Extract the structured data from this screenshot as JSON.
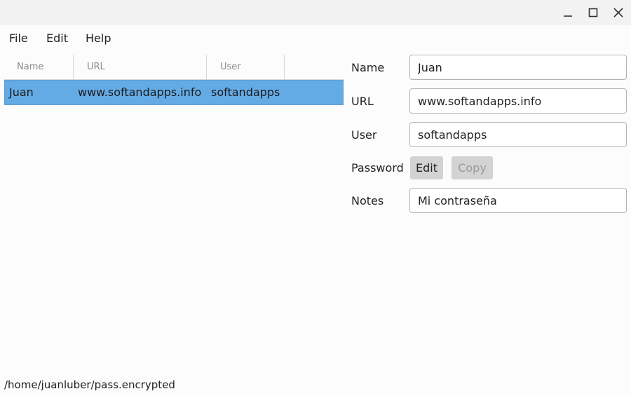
{
  "window": {
    "controls": [
      {
        "name": "minimize",
        "icon": "minimize-icon"
      },
      {
        "name": "maximize",
        "icon": "maximize-icon"
      },
      {
        "name": "close",
        "icon": "close-icon"
      }
    ]
  },
  "menu": {
    "items": [
      {
        "label": "File"
      },
      {
        "label": "Edit"
      },
      {
        "label": "Help"
      }
    ]
  },
  "table": {
    "columns": [
      "Name",
      "URL",
      "User"
    ],
    "rows": [
      {
        "name": "Juan",
        "url": "www.softandapps.info",
        "user": "softandapps",
        "selected": true
      }
    ],
    "selection_color": "#64abe5"
  },
  "form": {
    "name": {
      "label": "Name",
      "value": "Juan"
    },
    "url": {
      "label": "URL",
      "value": "www.softandapps.info"
    },
    "user": {
      "label": "User",
      "value": "softandapps"
    },
    "password": {
      "label": "Password",
      "edit_label": "Edit",
      "copy_label": "Copy",
      "copy_disabled": true
    },
    "notes": {
      "label": "Notes",
      "value": "Mi contraseña"
    }
  },
  "status": {
    "file_path": "/home/juanluber/pass.encrypted"
  }
}
